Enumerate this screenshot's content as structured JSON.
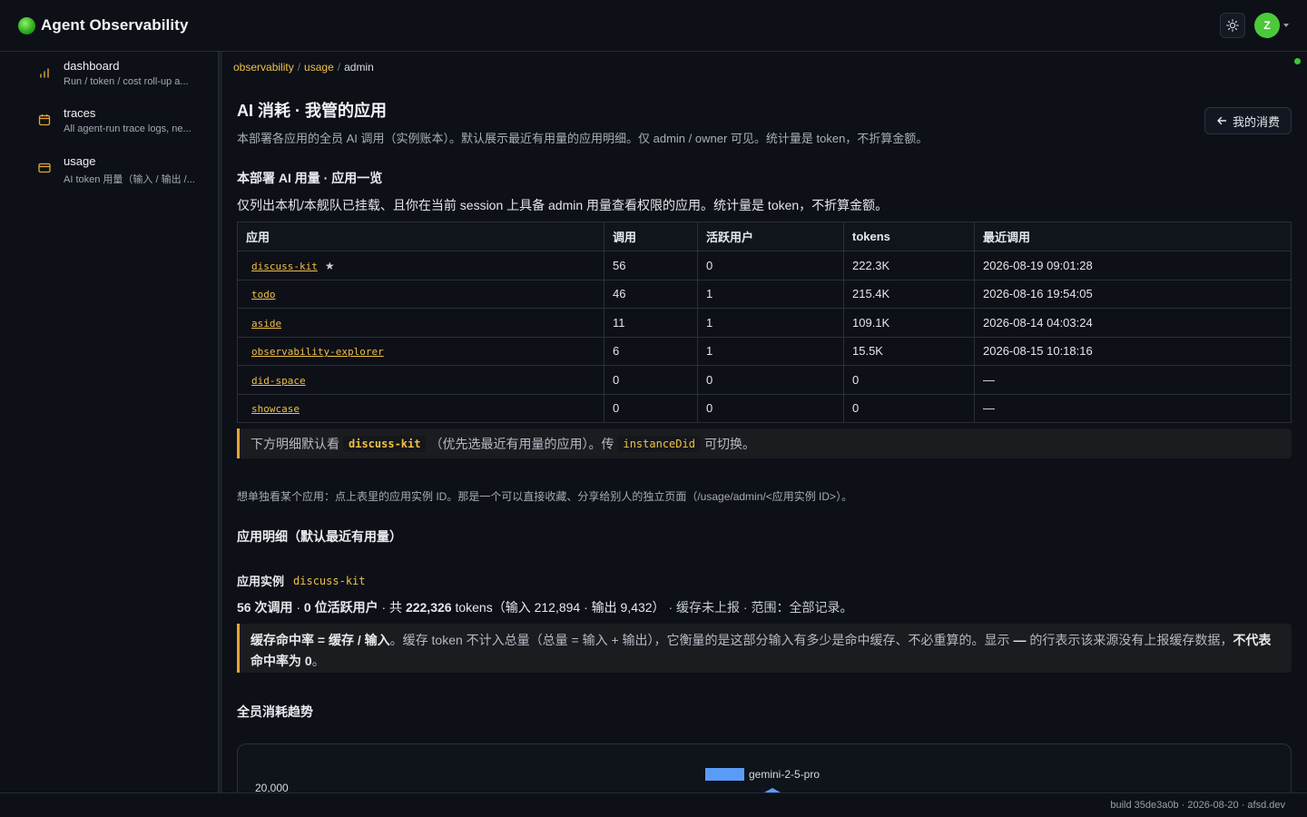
{
  "app": {
    "title": "Agent Observability",
    "avatar_initial": "Z"
  },
  "sidebar": {
    "items": [
      {
        "label": "dashboard",
        "desc": "Run / token / cost roll-up a..."
      },
      {
        "label": "traces",
        "desc": "All agent-run trace logs, ne..."
      },
      {
        "label": "usage",
        "desc": "AI token 用量（输入 / 输出 /..."
      }
    ]
  },
  "breadcrumb": {
    "items": [
      "observability",
      "usage"
    ],
    "current": "admin",
    "sep": "/"
  },
  "page": {
    "title": "AI 消耗 · 我管的应用",
    "desc": "本部署各应用的全员 AI 调用（实例账本）。默认展示最近有用量的应用明细。仅 admin / owner 可见。统计量是 token，不折算金额。",
    "back_label": "我的消费"
  },
  "overview": {
    "heading": "本部署 AI 用量 · 应用一览",
    "subtitle": "仅列出本机/本舰队已挂载、且你在当前 session 上具备 admin 用量查看权限的应用。统计量是 token，不折算金额。",
    "columns": [
      "应用",
      "调用",
      "活跃用户",
      "tokens",
      "最近调用"
    ],
    "rows": [
      {
        "app": "discuss-kit",
        "starred": true,
        "calls": "56",
        "users": "0",
        "tokens": "222.3K",
        "last": "2026-08-19 09:01:28"
      },
      {
        "app": "todo",
        "starred": false,
        "calls": "46",
        "users": "1",
        "tokens": "215.4K",
        "last": "2026-08-16 19:54:05"
      },
      {
        "app": "aside",
        "starred": false,
        "calls": "11",
        "users": "1",
        "tokens": "109.1K",
        "last": "2026-08-14 04:03:24"
      },
      {
        "app": "observability-explorer",
        "starred": false,
        "calls": "6",
        "users": "1",
        "tokens": "15.5K",
        "last": "2026-08-15 10:18:16"
      },
      {
        "app": "did-space",
        "starred": false,
        "calls": "0",
        "users": "0",
        "tokens": "0",
        "last": "—"
      },
      {
        "app": "showcase",
        "starred": false,
        "calls": "0",
        "users": "0",
        "tokens": "0",
        "last": "—"
      }
    ],
    "note": {
      "prefix": "下方明细默认看",
      "app": "discuss-kit",
      "middle": "（优先选最近有用量的应用）。传",
      "param": "instanceDid",
      "suffix": "可切换。"
    },
    "hint": "想单独看某个应用：点上表里的应用实例 ID。那是一个可以直接收藏、分享给别人的独立页面（/usage/admin/<应用实例 ID>）。"
  },
  "detail": {
    "heading": "应用明细（默认最近有用量）",
    "instance_label": "应用实例",
    "instance_id": "discuss-kit",
    "summary": {
      "calls": "56 次调用",
      "dot1": " · ",
      "users": "0 位活跃用户",
      "dot2": " · 共 ",
      "tokens": "222,326",
      "rest": " tokens（输入 212,894 · 输出 9,432）",
      "cache": " · 缓存未上报 · 范围：全部记录。"
    },
    "cache_note": {
      "bold": "缓存命中率 = 缓存 / 输入",
      "body": "。缓存 token 不计入总量（总量 = 输入 + 输出），它衡量的是这部分输入有多少是命中缓存、不必重算的。显示 ",
      "dash": "—",
      "body2": " 的行表示该来源没有上报缓存数据，",
      "bold2": "不代表命中率为 0",
      "end": "。"
    },
    "trend_heading": "全员消耗趋势"
  },
  "chart_data": {
    "type": "area",
    "series": [
      {
        "name": "gemini-2-5-pro",
        "color": "#5a9cf5"
      }
    ],
    "y_ticks": [
      "20,000"
    ]
  },
  "footer": {
    "text": "build 35de3a0b · 2026-08-20 · afsd.dev"
  }
}
